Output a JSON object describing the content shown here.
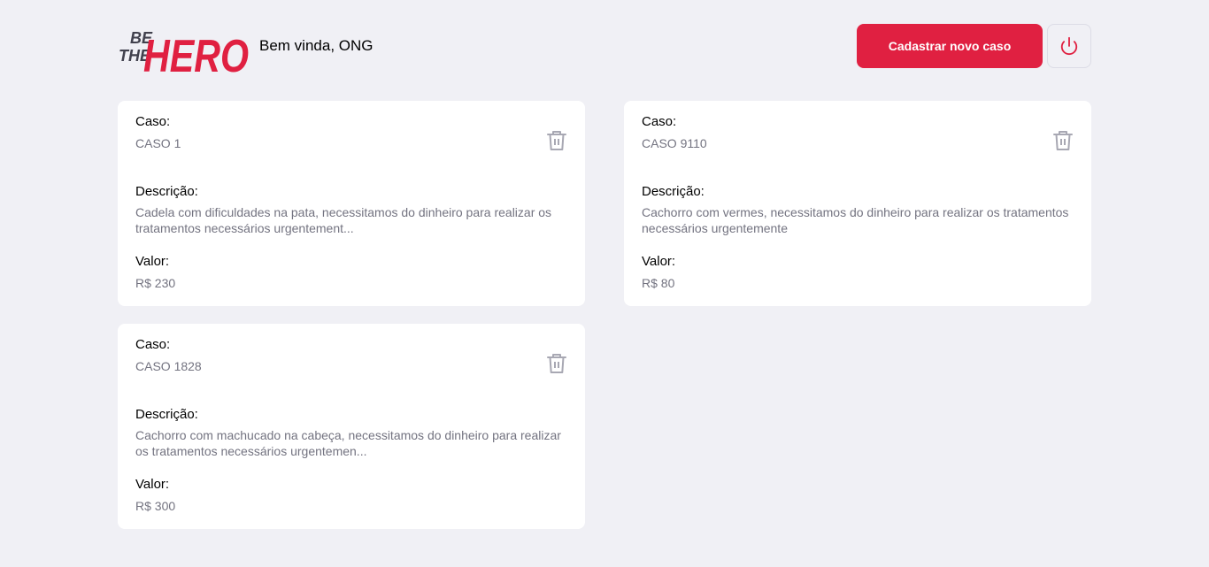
{
  "header": {
    "logo": {
      "line1": "BE",
      "line2": "THE",
      "word": "HERO"
    },
    "welcome": "Bem vinda, ONG",
    "new_case_label": "Cadastrar novo caso"
  },
  "colors": {
    "brand": "#e02041",
    "background": "#f0f0f5",
    "muted_text": "#737380",
    "icon_gray": "#a8a8b3"
  },
  "labels": {
    "case": "Caso:",
    "description": "Descrição:",
    "value": "Valor:"
  },
  "cases": [
    {
      "title": "CASO 1",
      "description": "Cadela com dificuldades na pata, necessitamos do dinheiro para realizar os tratamentos necessários urgentement...",
      "value": "R$ 230"
    },
    {
      "title": "CASO 9110",
      "description": "Cachorro com vermes, necessitamos do dinheiro para realizar os tratamentos necessários urgentemente",
      "value": "R$ 80"
    },
    {
      "title": "CASO 1828",
      "description": "Cachorro com machucado na cabeça, necessitamos do dinheiro para realizar os tratamentos necessários urgentemen...",
      "value": "R$ 300"
    }
  ]
}
